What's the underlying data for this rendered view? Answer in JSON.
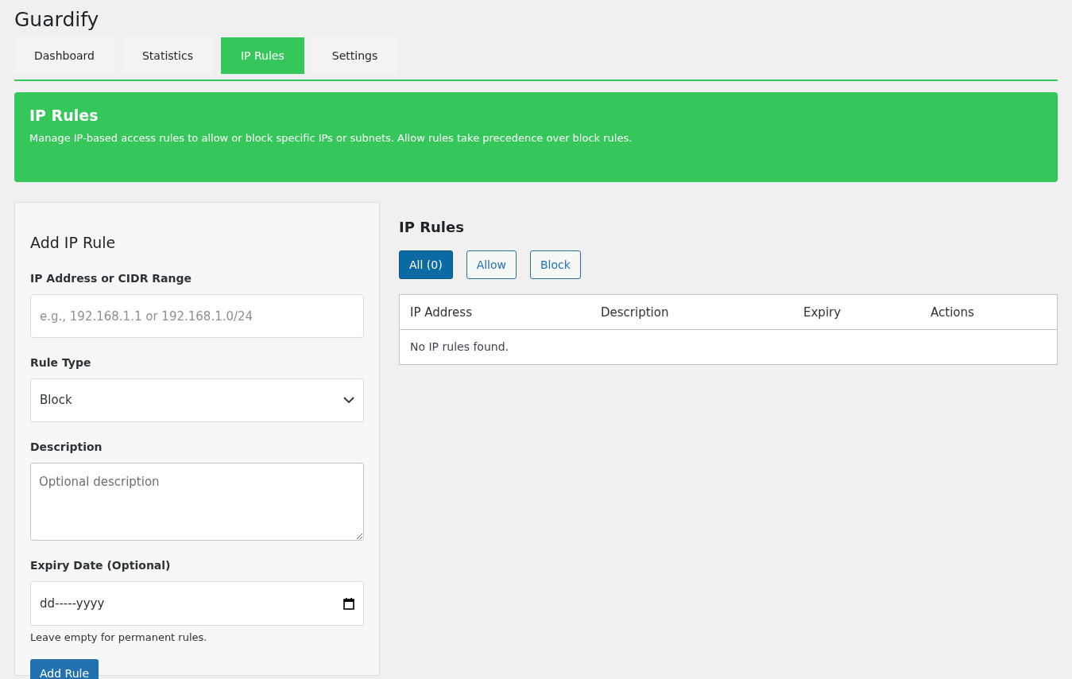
{
  "app_title": "Guardify",
  "tabs": [
    {
      "label": "Dashboard",
      "selected": false
    },
    {
      "label": "Statistics",
      "selected": false
    },
    {
      "label": "IP Rules",
      "selected": true
    },
    {
      "label": "Settings",
      "selected": false
    }
  ],
  "banner": {
    "title": "IP Rules",
    "text": "Manage IP-based access rules to allow or block specific IPs or subnets. Allow rules take precedence over block rules."
  },
  "form": {
    "title": "Add IP Rule",
    "fields": [
      {
        "kind": "text",
        "label": "IP Address or CIDR Range",
        "placeholder": "e.g., 192.168.1.1 or 192.168.1.0/24"
      },
      {
        "kind": "select",
        "label": "Rule Type",
        "value": "Block"
      },
      {
        "kind": "textarea",
        "label": "Description",
        "placeholder": "Optional description"
      },
      {
        "kind": "date",
        "label": "Expiry Date (Optional)",
        "placeholder": "dd-----yyyy",
        "help": "Leave empty for permanent rules."
      }
    ],
    "submit": "Add Rule"
  },
  "rules": {
    "title": "IP Rules",
    "filters": [
      {
        "label": "All (0)",
        "selected": true
      },
      {
        "label": "Allow",
        "selected": false
      },
      {
        "label": "Block",
        "selected": false
      }
    ],
    "columns": [
      "IP Address",
      "Description",
      "Expiry",
      "Actions"
    ],
    "empty_message": "No IP rules found."
  }
}
